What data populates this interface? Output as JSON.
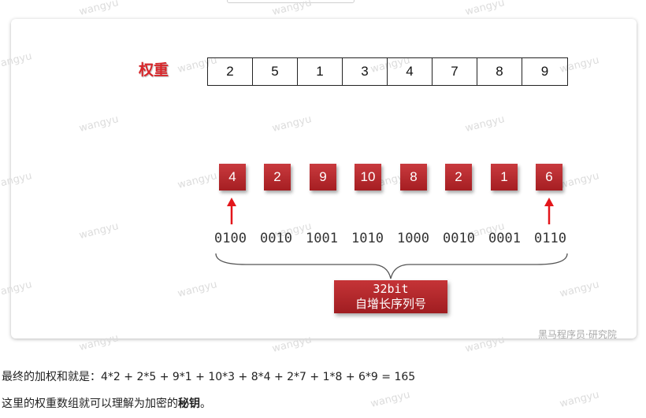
{
  "diagram": {
    "weight_title": "权重",
    "weights": [
      "2",
      "5",
      "1",
      "3",
      "4",
      "7",
      "8",
      "9"
    ],
    "id_digits": [
      "4",
      "2",
      "9",
      "10",
      "8",
      "2",
      "1",
      "6"
    ],
    "binary_groups": [
      "0100",
      "0010",
      "1001",
      "1010",
      "1000",
      "0010",
      "0001",
      "0110"
    ],
    "badge_line1": "32bit",
    "badge_line2": "自增长序列号",
    "credit": "黑马程序员·研究院",
    "watermark": "wangyu",
    "accent_color": "#c0282c"
  },
  "text": {
    "line1": "最终的加权和就是：4*2 + 2*5 + 9*1 + 10*3 + 8*4 + 2*7 + 1*8 + 6*9 = 165",
    "line2_prefix": "这里的权重数组就可以理解为加密的",
    "line2_bold": "秘钥",
    "line2_suffix": "。"
  }
}
